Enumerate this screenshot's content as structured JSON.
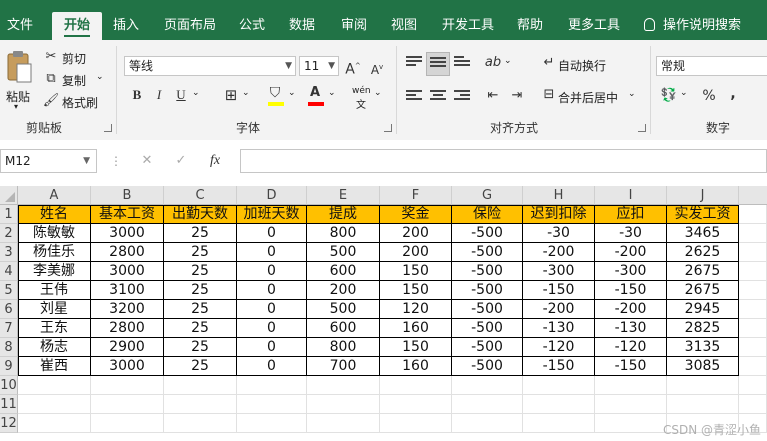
{
  "ribbon_tabs": [
    "文件",
    "开始",
    "插入",
    "页面布局",
    "公式",
    "数据",
    "审阅",
    "视图",
    "开发工具",
    "帮助",
    "更多工具",
    "操作说明搜索"
  ],
  "ribbon": {
    "clipboard": {
      "paste": "粘贴",
      "cut": "剪切",
      "copy": "复制",
      "format_painter": "格式刷",
      "label": "剪贴板"
    },
    "font": {
      "name": "等线",
      "size": "11",
      "bold": "B",
      "italic": "I",
      "underline": "U",
      "phonetic": "wén",
      "label": "字体"
    },
    "alignment": {
      "wrap_text": "自动换行",
      "merge_center": "合并后居中",
      "label": "对齐方式"
    },
    "number": {
      "format": "常规",
      "percent": "%",
      "comma": ",",
      "label": "数字"
    }
  },
  "formula_bar": {
    "name_box": "M12",
    "fx": "fx",
    "cancel": "✕",
    "enter": "✓",
    "value": ""
  },
  "sheet": {
    "columns": [
      "A",
      "B",
      "C",
      "D",
      "E",
      "F",
      "G",
      "H",
      "I",
      "J"
    ],
    "rows": [
      "1",
      "2",
      "3",
      "4",
      "5",
      "6",
      "7",
      "8",
      "9",
      "10",
      "11",
      "12"
    ],
    "header": [
      "姓名",
      "基本工资",
      "出勤天数",
      "加班天数",
      "提成",
      "奖金",
      "保险",
      "迟到扣除",
      "应扣",
      "实发工资"
    ],
    "data": [
      [
        "陈敏敏",
        "3000",
        "25",
        "0",
        "800",
        "200",
        "-500",
        "-30",
        "-30",
        "3465"
      ],
      [
        "杨佳乐",
        "2800",
        "25",
        "0",
        "500",
        "200",
        "-500",
        "-200",
        "-200",
        "2625"
      ],
      [
        "李美娜",
        "3000",
        "25",
        "0",
        "600",
        "150",
        "-500",
        "-300",
        "-300",
        "2675"
      ],
      [
        "王伟",
        "3100",
        "25",
        "0",
        "200",
        "150",
        "-500",
        "-150",
        "-150",
        "2675"
      ],
      [
        "刘星",
        "3200",
        "25",
        "0",
        "500",
        "120",
        "-500",
        "-200",
        "-200",
        "2945"
      ],
      [
        "王东",
        "2800",
        "25",
        "0",
        "600",
        "160",
        "-500",
        "-130",
        "-130",
        "2825"
      ],
      [
        "杨志",
        "2900",
        "25",
        "0",
        "800",
        "150",
        "-500",
        "-120",
        "-120",
        "3135"
      ],
      [
        "崔西",
        "3000",
        "25",
        "0",
        "700",
        "160",
        "-500",
        "-150",
        "-150",
        "3085"
      ]
    ]
  },
  "watermark": "CSDN @青涩小鱼",
  "colors": {
    "brand_green": "#217346",
    "header_fill": "#ffc000",
    "font_color_red": "#ff0000",
    "highlight_yellow": "#ffff00"
  }
}
